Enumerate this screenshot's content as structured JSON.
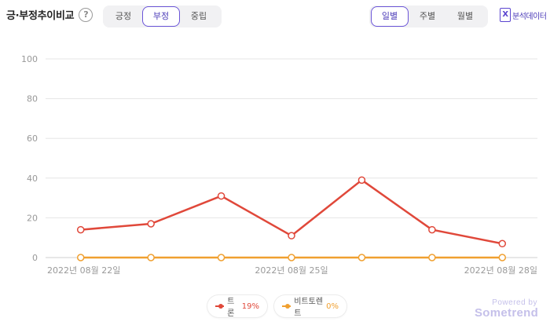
{
  "header": {
    "title": "긍·부정추이비교",
    "help_label": "?"
  },
  "sentiment_tabs": [
    {
      "label": "긍정",
      "active": false
    },
    {
      "label": "부정",
      "active": true
    },
    {
      "label": "중립",
      "active": false
    }
  ],
  "period_tabs": [
    {
      "label": "일별",
      "active": true
    },
    {
      "label": "주별",
      "active": false
    },
    {
      "label": "월별",
      "active": false
    }
  ],
  "export": {
    "label": "분석데이터",
    "icon": "excel-icon"
  },
  "chart_data": {
    "type": "line",
    "x": [
      "2022-08-22",
      "2022-08-23",
      "2022-08-24",
      "2022-08-25",
      "2022-08-26",
      "2022-08-27",
      "2022-08-28"
    ],
    "x_tick_labels": [
      {
        "index": 0,
        "label": "2022년 08월 22일"
      },
      {
        "index": 3,
        "label": "2022년 08월 25일"
      },
      {
        "index": 6,
        "label": "2022년 08월 28일"
      }
    ],
    "ylim": [
      0,
      100
    ],
    "yticks": [
      0,
      20,
      40,
      60,
      80,
      100
    ],
    "grid": true,
    "series": [
      {
        "name": "트론",
        "color": "#e0483a",
        "values": [
          14,
          17,
          31,
          11,
          39,
          14,
          7
        ],
        "pct": "19%"
      },
      {
        "name": "비트토렌트",
        "color": "#f0a030",
        "values": [
          0,
          0,
          0,
          0,
          0,
          0,
          0
        ],
        "pct": "0%"
      }
    ],
    "legend_position": "bottom"
  },
  "branding": {
    "line1": "Powered by",
    "line2": "Sometrend"
  }
}
